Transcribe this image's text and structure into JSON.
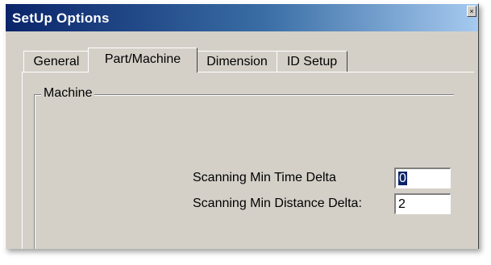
{
  "window": {
    "title": "SetUp Options"
  },
  "tabs": [
    {
      "label": "General",
      "active": false
    },
    {
      "label": "Part/Machine",
      "active": true
    },
    {
      "label": "Dimension",
      "active": false
    },
    {
      "label": "ID Setup",
      "active": false
    }
  ],
  "machine_group": {
    "label": "Machine",
    "fields": [
      {
        "label": "Scanning Min Time Delta",
        "value": "0"
      },
      {
        "label": "Scanning Min Distance Delta:",
        "value": "2"
      }
    ]
  }
}
